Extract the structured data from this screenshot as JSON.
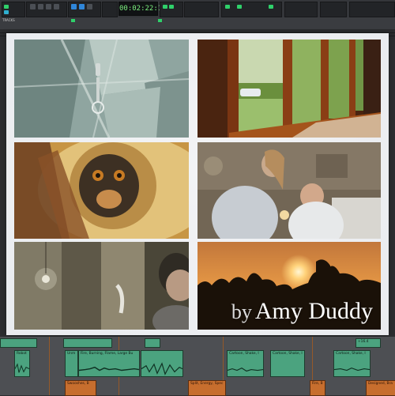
{
  "daw": {
    "counter": "00:02:22:19",
    "track_header_label": "TRACKS",
    "accent_green": "#3fd36f",
    "accent_blue": "#2f86d9"
  },
  "card": {
    "frames": [
      {
        "name": "frame-blanket-keychain",
        "kind": "image"
      },
      {
        "name": "frame-window-view",
        "kind": "image"
      },
      {
        "name": "frame-monkey-closeup",
        "kind": "image"
      },
      {
        "name": "frame-women-bedroom",
        "kind": "image"
      },
      {
        "name": "frame-kitchen-lamp",
        "kind": "image"
      },
      {
        "name": "frame-sunset-trees",
        "kind": "image"
      }
    ],
    "credit_by": "by",
    "credit_name": "Amy Duddy"
  },
  "timeline": {
    "row1_clips": [
      {
        "label": ""
      },
      {
        "label": ""
      },
      {
        "label": ""
      },
      {
        "label": "+16.4"
      }
    ],
    "row2_clips": [
      {
        "label": "Robot"
      },
      {
        "label": "Unm"
      },
      {
        "label": "Fire, Burning, Flame, Large Bu"
      },
      {
        "label": "Cartoon, Shake, I"
      },
      {
        "label": "Cartoon, Shake, I"
      },
      {
        "label": "Cartoon, Shake, I"
      }
    ],
    "row3_clips": [
      {
        "label": "Swooshes, B"
      },
      {
        "label": "Split, Energy, Spec"
      },
      {
        "label": "Fire, B"
      },
      {
        "label": "Designed, Bra"
      }
    ]
  }
}
